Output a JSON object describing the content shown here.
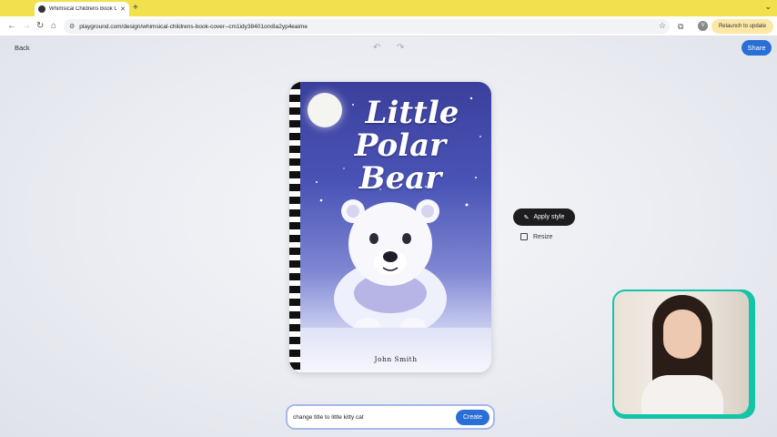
{
  "browser": {
    "tab_title": "Whimsical Childrens Book Co",
    "url": "playground.com/design/whimsical-childrens-book-cover--cm1idy38401orx8a2yp4eaime",
    "relaunch_label": "Relaunch to update",
    "profile_initial": "V"
  },
  "app": {
    "back_label": "Back",
    "share_label": "Share",
    "apply_style_label": "Apply style",
    "resize_label": "Resize",
    "prompt_value": "change title to little kitty cat",
    "create_label": "Create"
  },
  "cover": {
    "title_line1": "Little",
    "title_line2": "Polar Bear",
    "author": "John Smith"
  },
  "colors": {
    "accent": "#2a6fd6",
    "tab_bar": "#f2e04c",
    "webcam_border": "#14c4a8"
  }
}
